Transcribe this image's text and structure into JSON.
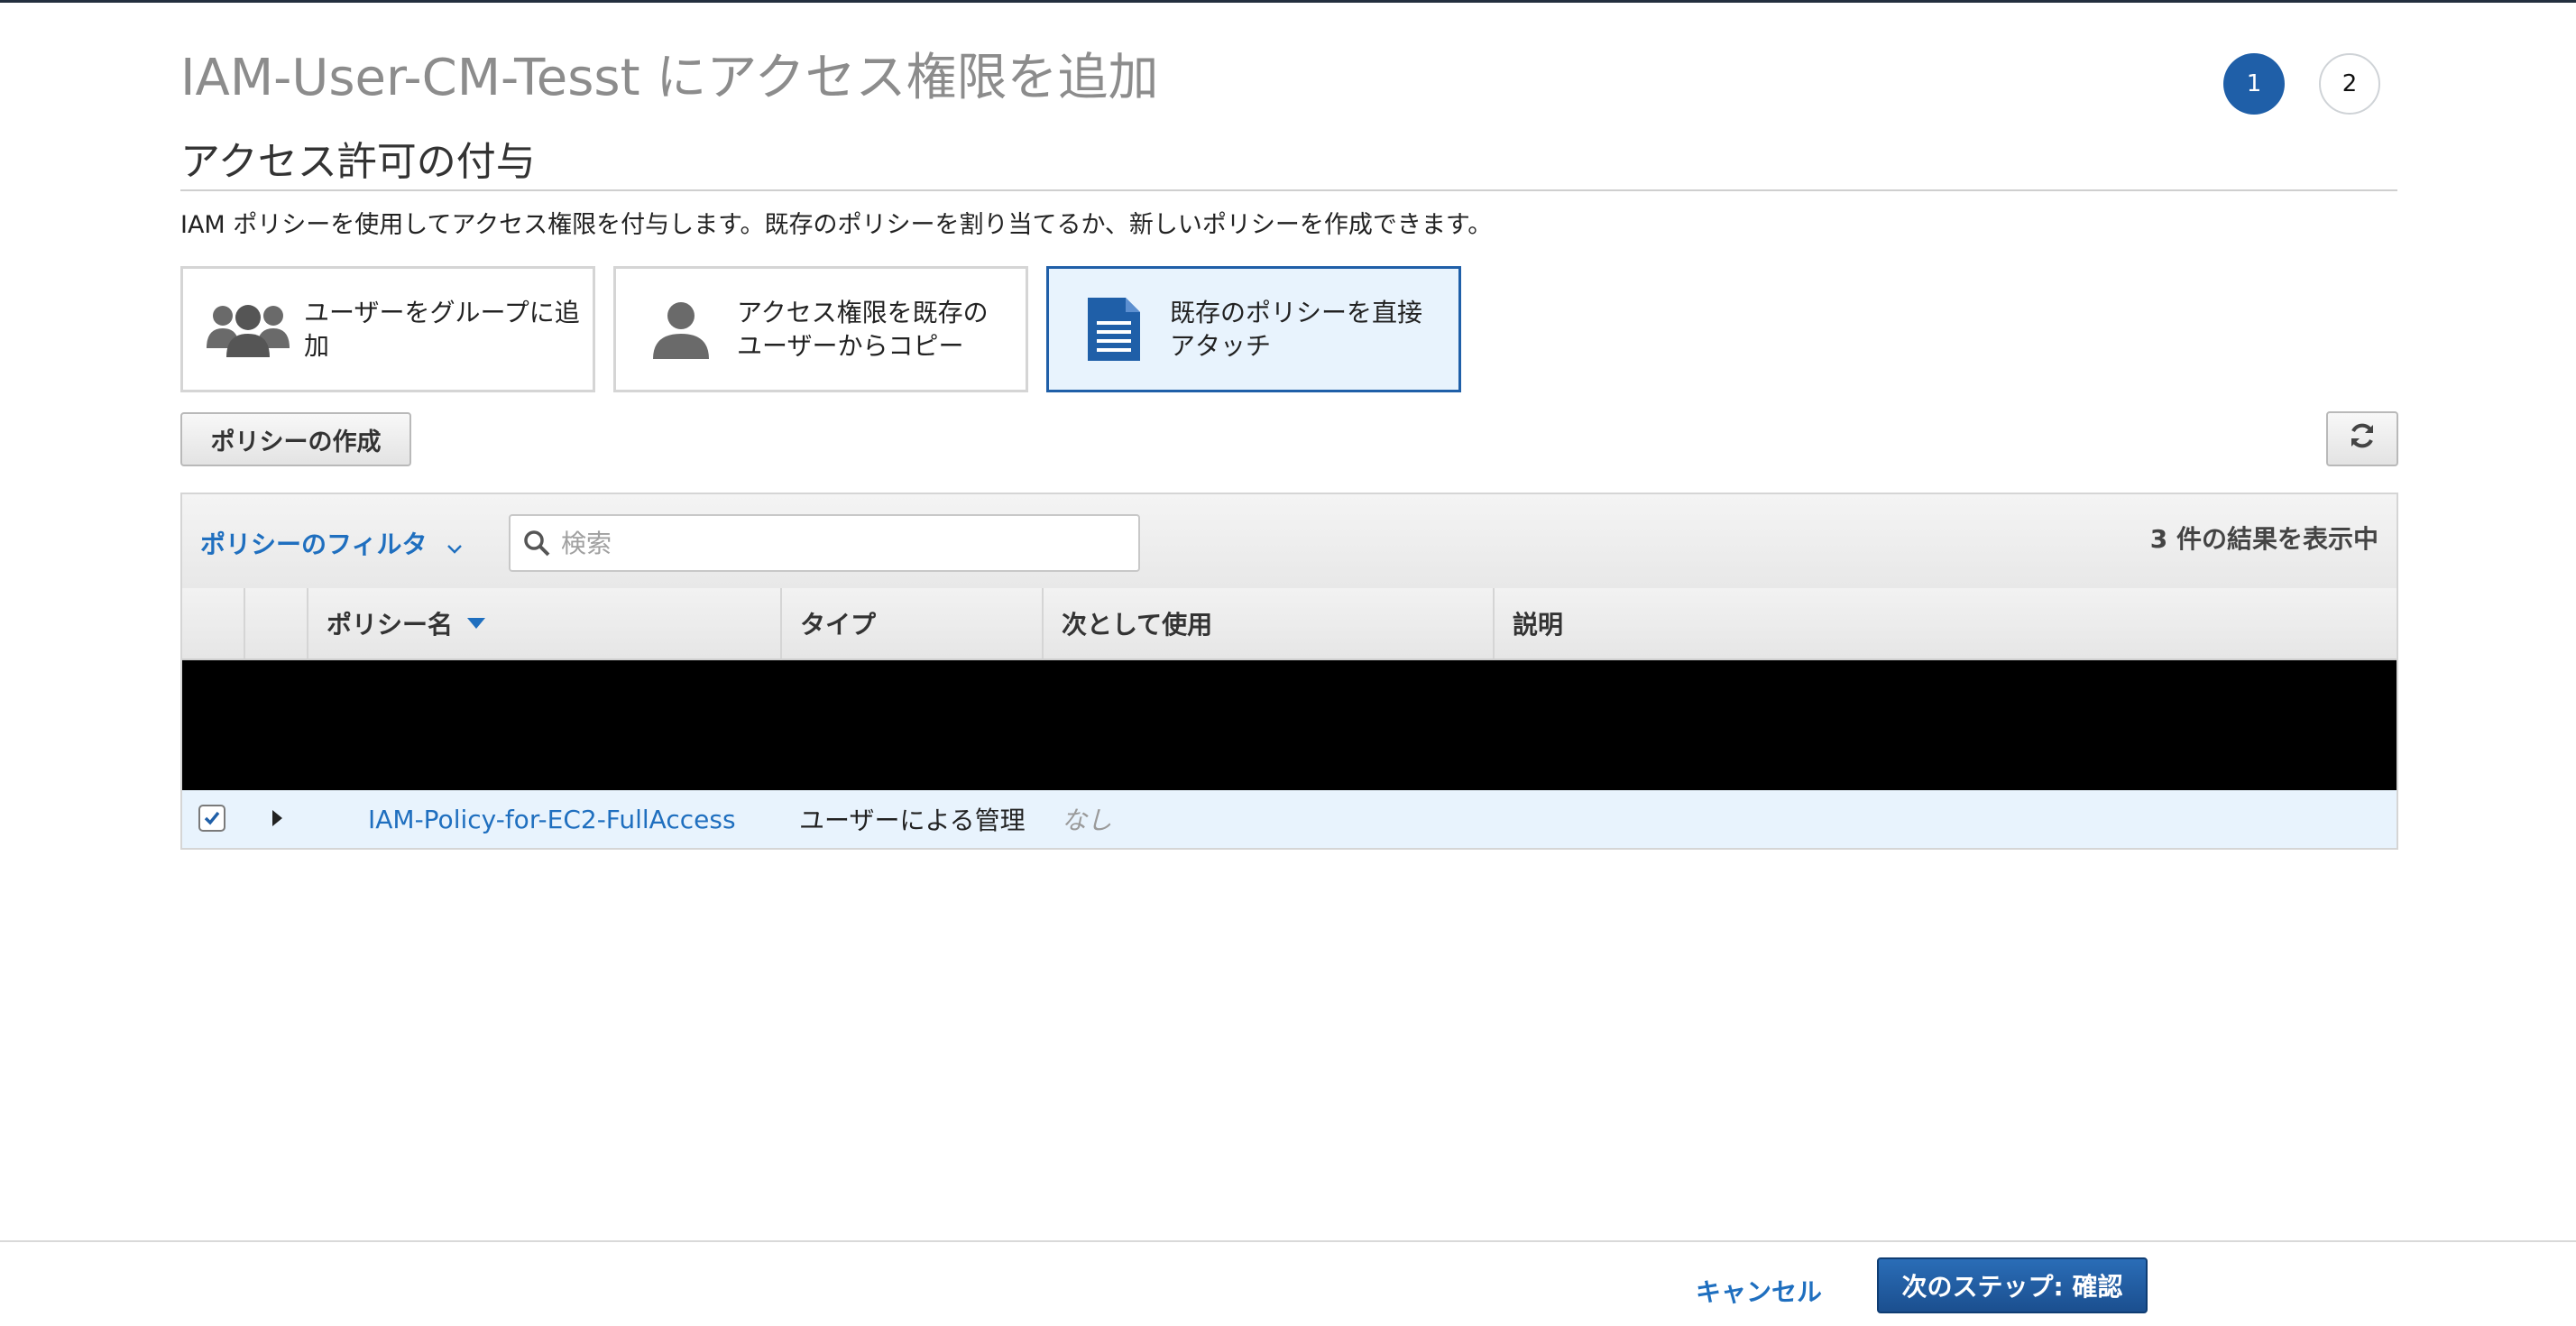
{
  "page": {
    "title": "IAM-User-CM-Tesst にアクセス権限を追加",
    "steps": [
      "1",
      "2"
    ],
    "section_title": "アクセス許可の付与",
    "description": "IAM ポリシーを使用してアクセス権限を付与します。既存のポリシーを割り当てるか、新しいポリシーを作成できます。"
  },
  "options": [
    {
      "label": "ユーザーをグループに追加",
      "icon": "users-group-icon",
      "selected": false
    },
    {
      "label": "アクセス権限を既存のユーザーからコピー",
      "icon": "user-icon",
      "selected": false
    },
    {
      "label": "既存のポリシーを直接アタッチ",
      "icon": "document-icon",
      "selected": true
    }
  ],
  "actions": {
    "create_policy": "ポリシーの作成",
    "refresh_icon": "refresh-icon"
  },
  "table": {
    "filter_label": "ポリシーのフィルタ",
    "search_placeholder": "検索",
    "result_count": "3 件の結果を表示中",
    "columns": [
      "ポリシー名",
      "タイプ",
      "次として使用",
      "説明"
    ],
    "sort_column": "ポリシー名",
    "rows": [
      {
        "checked": true,
        "policy_name": "IAM-Policy-for-EC2-FullAccess",
        "type": "ユーザーによる管理",
        "used_as": "なし",
        "description": ""
      }
    ]
  },
  "footer": {
    "cancel": "キャンセル",
    "next": "次のステップ: 確認"
  },
  "colors": {
    "accent": "#1f5fa8",
    "link": "#1f6fbf",
    "selected_bg": "#e8f3fd",
    "title_gray": "#8c8c8c"
  }
}
